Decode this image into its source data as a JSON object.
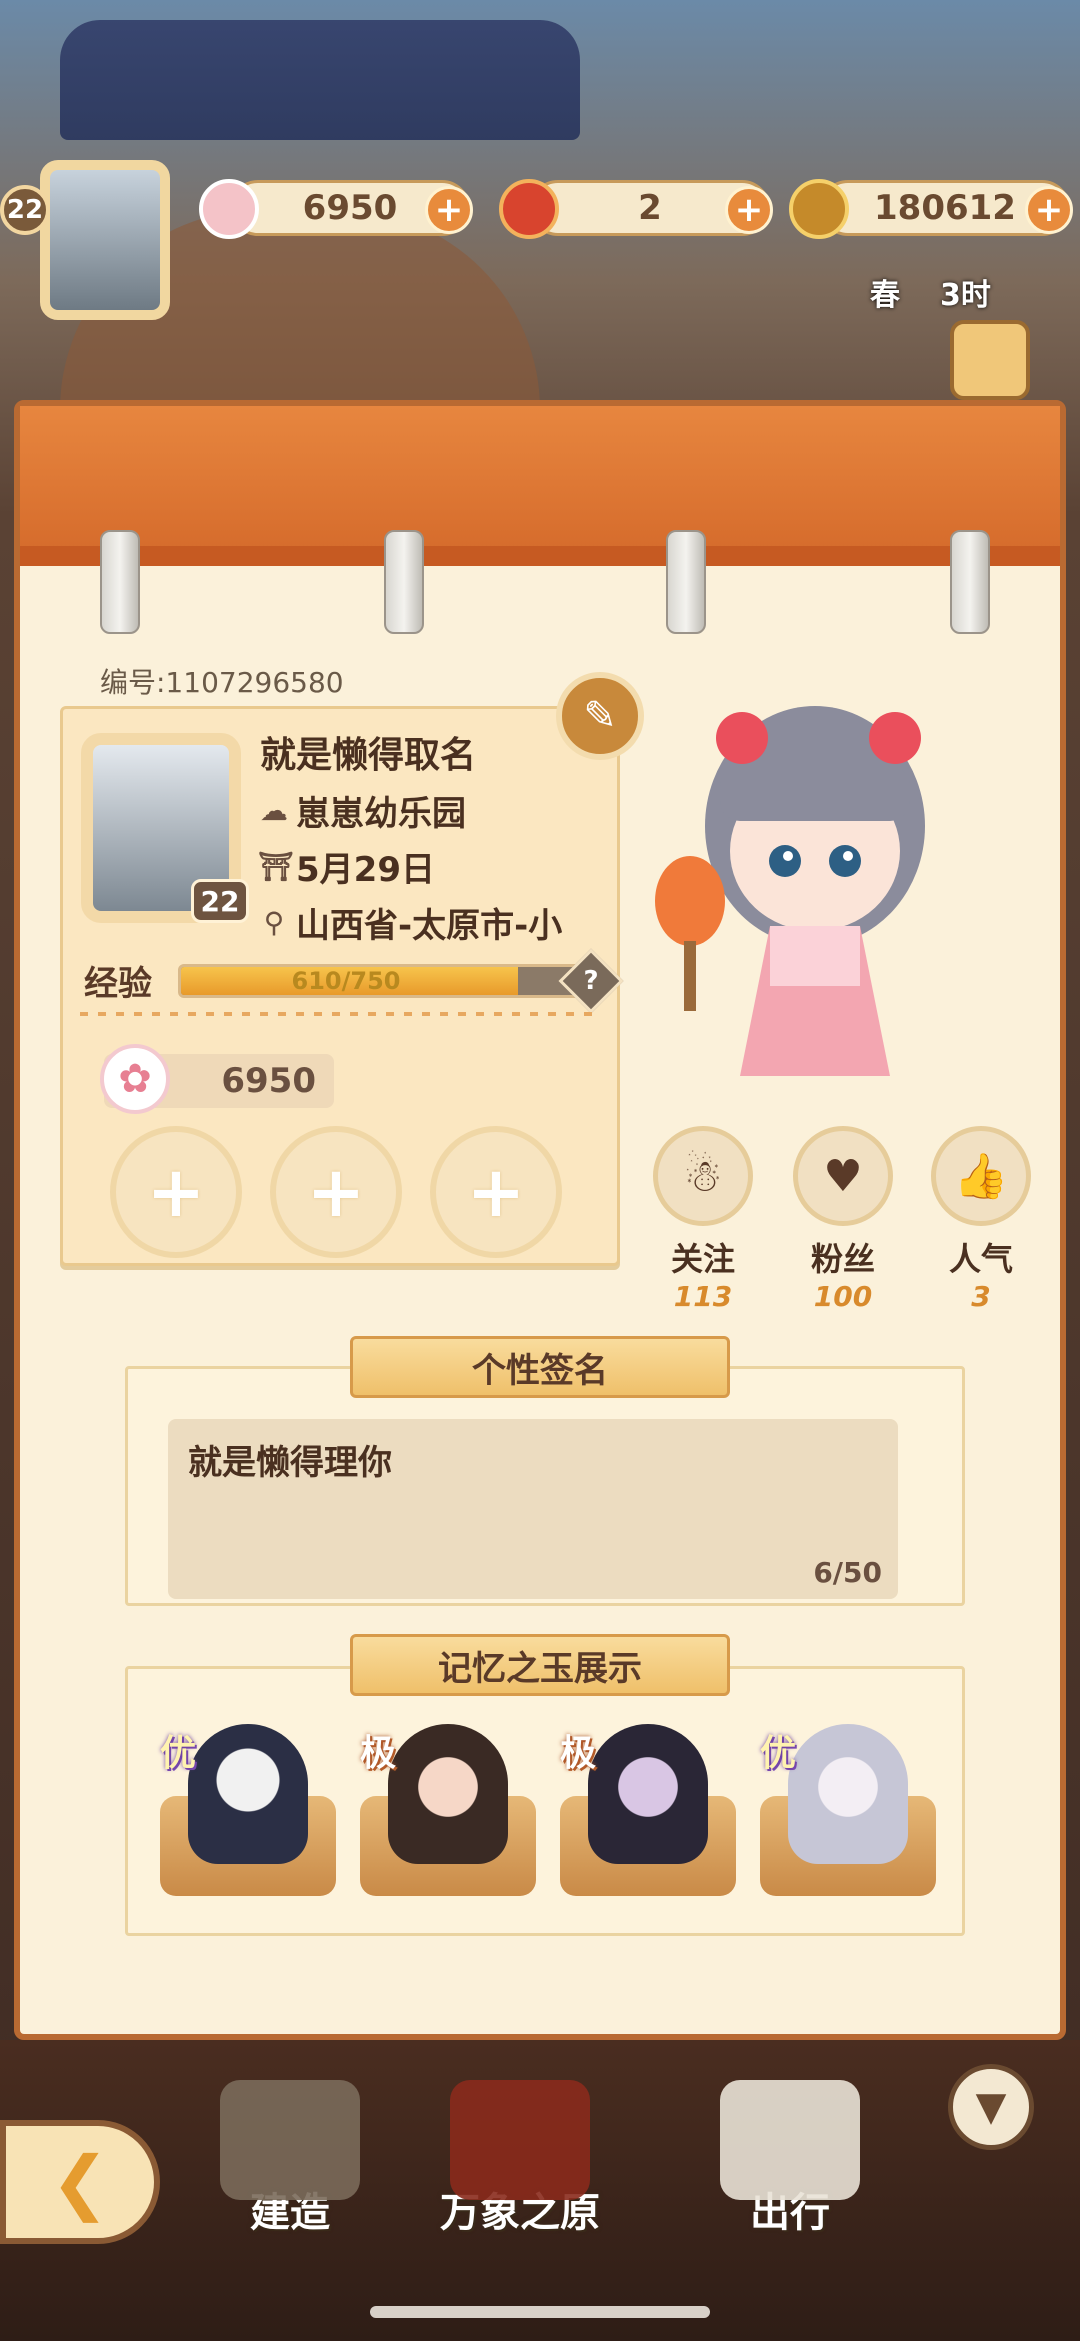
{
  "hud": {
    "level": "22",
    "flowers": "6950",
    "tickets": "2",
    "coins": "180612",
    "season": "春",
    "time": "3时"
  },
  "profile": {
    "id_label": "编号:1107296580",
    "nickname": "就是懒得取名",
    "guild": "崽崽幼乐园",
    "birthday": "5月29日",
    "location": "山西省-太原市-小",
    "level": "22",
    "exp_label": "经验",
    "exp_text": "610/750",
    "exp_fraction": 0.813,
    "flowers": "6950"
  },
  "social": [
    {
      "label": "关注",
      "value": "113"
    },
    {
      "label": "粉丝",
      "value": "100"
    },
    {
      "label": "人气",
      "value": "3"
    }
  ],
  "signature": {
    "title": "个性签名",
    "text": "就是懒得理你",
    "count": "6/50"
  },
  "memory": {
    "title": "记忆之玉展示",
    "items": [
      {
        "tag": "优"
      },
      {
        "tag": "极"
      },
      {
        "tag": "极"
      },
      {
        "tag": "优"
      }
    ]
  },
  "nav": {
    "build": "建造",
    "world": "万象之原",
    "travel": "出行"
  },
  "icons": {
    "plus": "+",
    "back": "❮",
    "down": "▼",
    "edit": "✎",
    "help": "?"
  }
}
